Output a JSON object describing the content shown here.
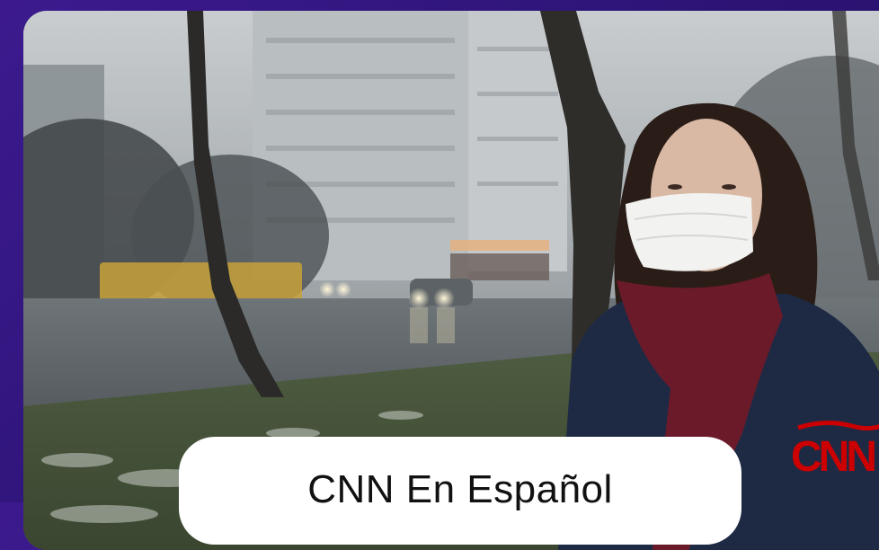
{
  "caption": {
    "text": "CNN En Español"
  },
  "logo": {
    "text": "CNN",
    "color": "#cc0000"
  },
  "colors": {
    "background": "#2c1476",
    "scarf": "#6b1a2a",
    "coat": "#1e2a44",
    "mask": "#f2f2f0"
  }
}
